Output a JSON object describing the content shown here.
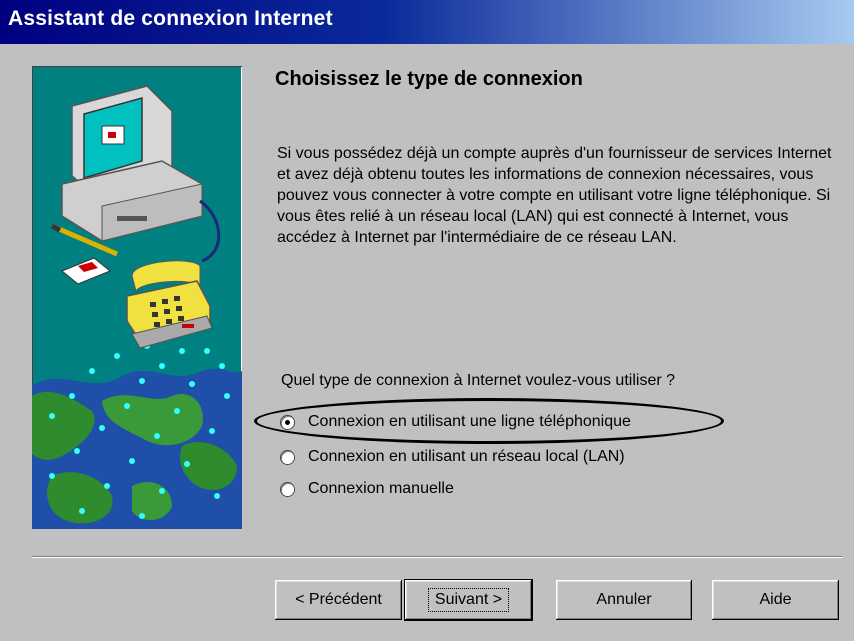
{
  "window": {
    "title": "Assistant de connexion Internet"
  },
  "page": {
    "heading": "Choisissez le type de connexion",
    "description": "Si vous possédez déjà un compte auprès d'un fournisseur de services Internet et avez déjà obtenu toutes les informations de connexion nécessaires, vous pouvez vous connecter à votre compte en utilisant votre ligne téléphonique. Si vous êtes relié à un réseau local (LAN) qui est connecté à Internet, vous accédez à Internet par l'intermédiaire de ce réseau LAN.",
    "question": "Quel type de connexion à Internet voulez-vous utiliser ?"
  },
  "options": [
    {
      "label": "Connexion en utilisant une ligne téléphonique",
      "selected": true
    },
    {
      "label": "Connexion en utilisant un réseau local (LAN)",
      "selected": false
    },
    {
      "label": "Connexion manuelle",
      "selected": false
    }
  ],
  "buttons": {
    "back": "< Précédent",
    "next": "Suivant >",
    "cancel": "Annuler",
    "help": "Aide"
  },
  "colors": {
    "title_bar": "#000080",
    "dialog_bg": "#c0c0c0",
    "art_bg": "#008080"
  }
}
